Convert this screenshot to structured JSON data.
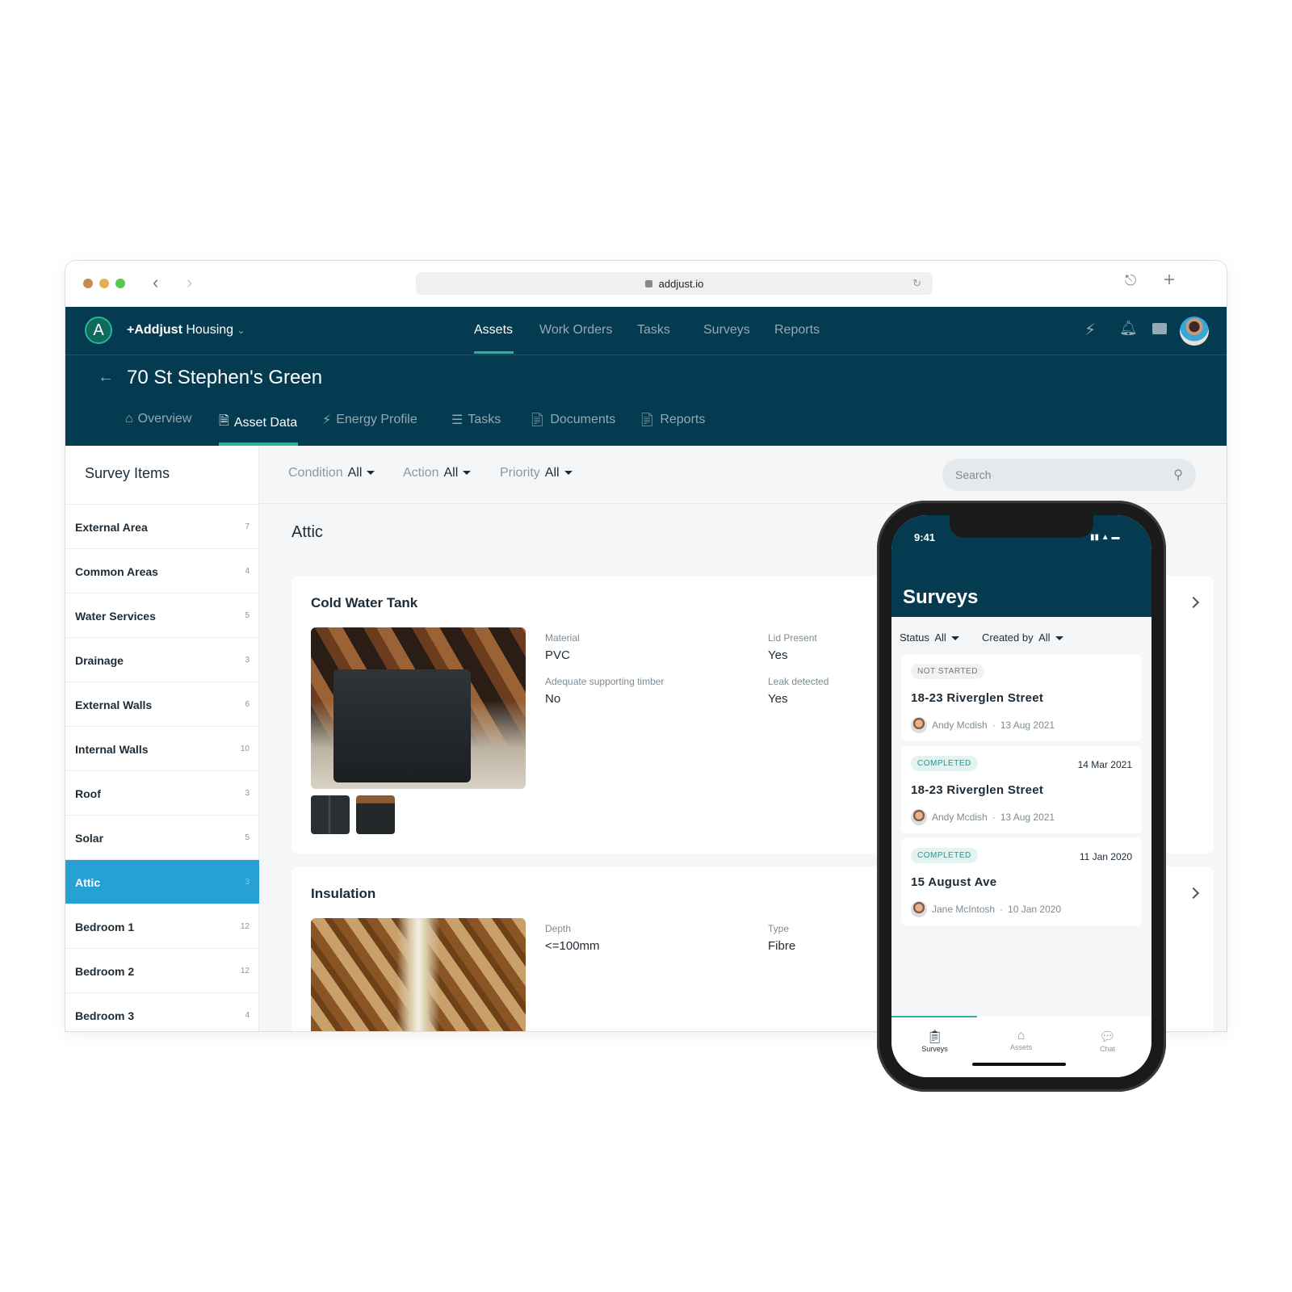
{
  "browser": {
    "url": "addjust.io"
  },
  "nav": {
    "brand_bold": "+Addjust",
    "brand_rest": "Housing",
    "items": [
      "Assets",
      "Work Orders",
      "Tasks",
      "Surveys",
      "Reports"
    ],
    "active": "Assets",
    "accent": "#2bb39a",
    "bg": "#053b50"
  },
  "page": {
    "title": "70 St Stephen's Green",
    "tabs": [
      {
        "label": "Overview",
        "icon": "home-icon"
      },
      {
        "label": "Asset Data",
        "icon": "document-icon"
      },
      {
        "label": "Energy Profile",
        "icon": "bolt-icon"
      },
      {
        "label": "Tasks",
        "icon": "checklist-icon"
      },
      {
        "label": "Documents",
        "icon": "file-icon"
      },
      {
        "label": "Reports",
        "icon": "file-icon"
      }
    ],
    "active_tab": "Asset Data"
  },
  "sidebar": {
    "title": "Survey Items",
    "items": [
      {
        "label": "External Area",
        "count": "7"
      },
      {
        "label": "Common Areas",
        "count": "4"
      },
      {
        "label": "Water Services",
        "count": "5"
      },
      {
        "label": "Drainage",
        "count": "3"
      },
      {
        "label": "External Walls",
        "count": "6"
      },
      {
        "label": "Internal Walls",
        "count": "10"
      },
      {
        "label": "Roof",
        "count": "3"
      },
      {
        "label": "Solar",
        "count": "5"
      },
      {
        "label": "Attic",
        "count": "3"
      },
      {
        "label": "Bedroom 1",
        "count": "12"
      },
      {
        "label": "Bedroom 2",
        "count": "12"
      },
      {
        "label": "Bedroom 3",
        "count": "4"
      }
    ],
    "active": "Attic",
    "active_color": "#27a1d4"
  },
  "filters": [
    {
      "label": "Condition",
      "value": "All"
    },
    {
      "label": "Action",
      "value": "All"
    },
    {
      "label": "Priority",
      "value": "All"
    }
  ],
  "search": {
    "placeholder": "Search"
  },
  "section": {
    "title": "Attic"
  },
  "cards": [
    {
      "title": "Cold Water Tank",
      "fields": [
        {
          "label": "Material",
          "value": "PVC"
        },
        {
          "label": "Lid Present",
          "value": "Yes"
        },
        {
          "label": "Adequate supporting timber",
          "value": "No"
        },
        {
          "label": "Leak detected",
          "value": "Yes"
        }
      ]
    },
    {
      "title": "Insulation",
      "fields": [
        {
          "label": "Depth",
          "value": "<=100mm"
        },
        {
          "label": "Type",
          "value": "Fibre"
        }
      ]
    }
  ],
  "phone": {
    "time": "9:41",
    "title": "Surveys",
    "filters": [
      {
        "label": "Status",
        "value": "All"
      },
      {
        "label": "Created by",
        "value": "All"
      }
    ],
    "surveys": [
      {
        "status": "NOT STARTED",
        "date": "",
        "address": "18-23 Riverglen Street",
        "author": "Andy Mcdish",
        "created": "13 Aug 2021"
      },
      {
        "status": "COMPLETED",
        "date": "14 Mar 2021",
        "address": "18-23 Riverglen Street",
        "author": "Andy Mcdish",
        "created": "13 Aug 2021"
      },
      {
        "status": "COMPLETED",
        "date": "11 Jan 2020",
        "address": "15 August Ave",
        "author": "Jane McIntosh",
        "created": "10 Jan 2020"
      }
    ],
    "tabs": [
      "Surveys",
      "Assets",
      "Chat"
    ],
    "active_tab": "Surveys"
  }
}
